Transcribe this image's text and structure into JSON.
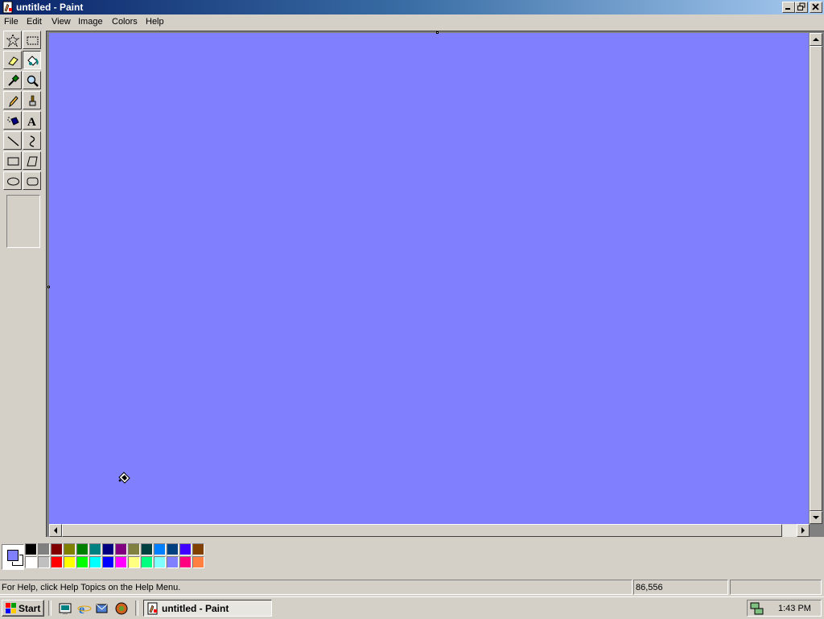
{
  "window": {
    "title": "untitled - Paint"
  },
  "menu": [
    {
      "label": "File"
    },
    {
      "label": "Edit"
    },
    {
      "label": "View"
    },
    {
      "label": "Image"
    },
    {
      "label": "Colors"
    },
    {
      "label": "Help"
    }
  ],
  "tools": [
    {
      "name": "free-form-select-tool",
      "icon": "star-select-icon",
      "selected": false
    },
    {
      "name": "rect-select-tool",
      "icon": "dashed-rect-icon",
      "selected": false
    },
    {
      "name": "eraser-tool",
      "icon": "eraser-icon",
      "selected": false
    },
    {
      "name": "fill-with-color-tool",
      "icon": "paint-bucket-icon",
      "selected": true
    },
    {
      "name": "pick-color-tool",
      "icon": "eyedropper-icon",
      "selected": false
    },
    {
      "name": "magnifier-tool",
      "icon": "magnifier-icon",
      "selected": false
    },
    {
      "name": "pencil-tool",
      "icon": "pencil-icon",
      "selected": false
    },
    {
      "name": "brush-tool",
      "icon": "brush-icon",
      "selected": false
    },
    {
      "name": "airbrush-tool",
      "icon": "airbrush-icon",
      "selected": false
    },
    {
      "name": "text-tool",
      "icon": "text-a-icon",
      "selected": false
    },
    {
      "name": "line-tool",
      "icon": "line-icon",
      "selected": false
    },
    {
      "name": "curve-tool",
      "icon": "curve-icon",
      "selected": false
    },
    {
      "name": "rectangle-tool",
      "icon": "rectangle-icon",
      "selected": false
    },
    {
      "name": "polygon-tool",
      "icon": "polygon-icon",
      "selected": false
    },
    {
      "name": "ellipse-tool",
      "icon": "ellipse-icon",
      "selected": false
    },
    {
      "name": "rounded-rectangle-tool",
      "icon": "rounded-rect-icon",
      "selected": false
    }
  ],
  "colors": {
    "canvas": "#8080ff",
    "foreground": "#8080ff",
    "background": "#ffffff",
    "palette_top": [
      "#000000",
      "#808080",
      "#800000",
      "#808000",
      "#008000",
      "#008080",
      "#000080",
      "#800080",
      "#808040",
      "#004040",
      "#0080ff",
      "#004080",
      "#4000ff",
      "#804000"
    ],
    "palette_bottom": [
      "#ffffff",
      "#c0c0c0",
      "#ff0000",
      "#ffff00",
      "#00ff00",
      "#00ffff",
      "#0000ff",
      "#ff00ff",
      "#ffff80",
      "#00ff80",
      "#80ffff",
      "#8080ff",
      "#ff0080",
      "#ff8040"
    ]
  },
  "status": {
    "help_text": "For Help, click Help Topics on the Help Menu.",
    "coords": "86,556",
    "size": ""
  },
  "taskbar": {
    "start_label": "Start",
    "task_label": "untitled - Paint",
    "clock": "1:43 PM"
  }
}
